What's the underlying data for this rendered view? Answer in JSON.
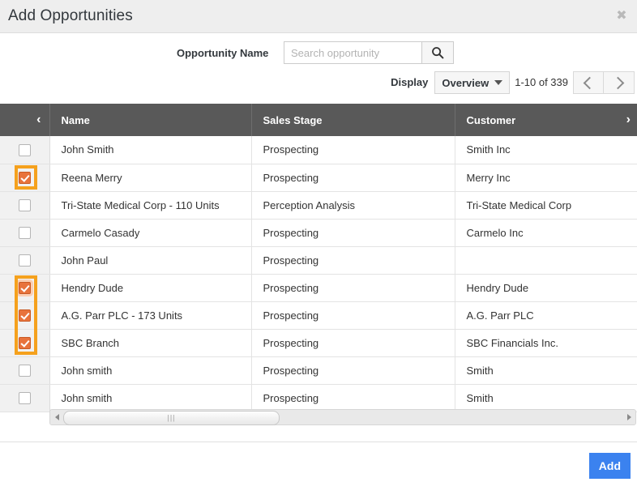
{
  "dialog": {
    "title": "Add Opportunities",
    "close_icon": "close-icon",
    "close_glyph": "✖"
  },
  "search": {
    "label": "Opportunity Name",
    "placeholder": "Search opportunity",
    "value": "",
    "button_icon": "search-icon"
  },
  "display": {
    "label": "Display",
    "selected_option": "Overview",
    "options": [
      "Overview"
    ],
    "caret_icon": "chevron-down-icon",
    "record_count": "1-10 of 339",
    "prev_icon": "chevron-left-icon",
    "next_icon": "chevron-right-icon"
  },
  "table": {
    "header_left_arrow": "‹",
    "header_right_arrow": "›",
    "columns": [
      {
        "key": "check",
        "label": ""
      },
      {
        "key": "name",
        "label": "Name"
      },
      {
        "key": "stage",
        "label": "Sales Stage"
      },
      {
        "key": "customer",
        "label": "Customer"
      }
    ],
    "rows": [
      {
        "selected": false,
        "focused": false,
        "name": "John Smith",
        "stage": "Prospecting",
        "customer": "Smith Inc"
      },
      {
        "selected": true,
        "focused": false,
        "name": "Reena Merry",
        "stage": "Prospecting",
        "customer": "Merry Inc"
      },
      {
        "selected": false,
        "focused": false,
        "name": "Tri-State Medical Corp - 110 Units",
        "stage": "Perception Analysis",
        "customer": "Tri-State Medical Corp"
      },
      {
        "selected": false,
        "focused": false,
        "name": "Carmelo Casady",
        "stage": "Prospecting",
        "customer": "Carmelo Inc"
      },
      {
        "selected": false,
        "focused": false,
        "name": "John Paul",
        "stage": "Prospecting",
        "customer": ""
      },
      {
        "selected": true,
        "focused": true,
        "name": "Hendry Dude",
        "stage": "Prospecting",
        "customer": "Hendry Dude"
      },
      {
        "selected": true,
        "focused": false,
        "name": "A.G. Parr PLC - 173 Units",
        "stage": "Prospecting",
        "customer": "A.G. Parr PLC"
      },
      {
        "selected": true,
        "focused": false,
        "name": "SBC Branch",
        "stage": "Prospecting",
        "customer": "SBC Financials Inc."
      },
      {
        "selected": false,
        "focused": false,
        "name": "John smith",
        "stage": "Prospecting",
        "customer": "Smith"
      },
      {
        "selected": false,
        "focused": false,
        "name": "John smith",
        "stage": "Prospecting",
        "customer": "Smith"
      }
    ]
  },
  "scrollbar": {
    "left_arrow_icon": "triangle-left-icon",
    "right_arrow_icon": "triangle-right-icon",
    "grip": "|||"
  },
  "footer": {
    "add_label": "Add"
  },
  "colors": {
    "accent_selection": "#f5a11d",
    "checkbox_checked": "#e8733c",
    "row_selected_bg": "#fbf8dc",
    "header_bg": "#595959",
    "primary_button": "#3b82ef"
  }
}
